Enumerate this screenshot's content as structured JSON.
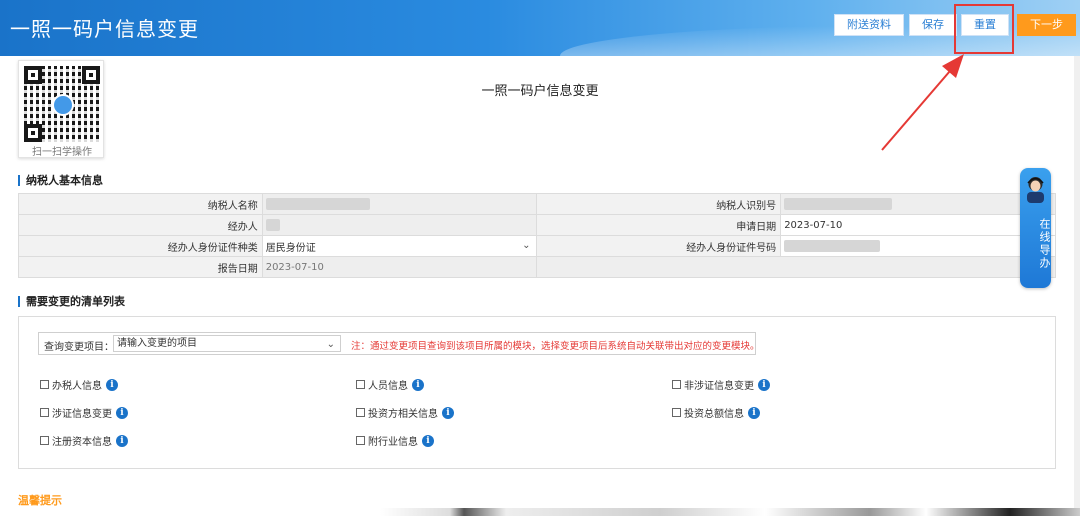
{
  "header": {
    "title": "一照一码户信息变更",
    "buttons": {
      "attach": "附送资料",
      "save": "保存",
      "reset": "重置",
      "next": "下一步"
    }
  },
  "qr": {
    "caption": "扫一扫学操作"
  },
  "page_title": "一照一码户信息变更",
  "basic_info": {
    "section_title": "纳税人基本信息",
    "fields": {
      "taxpayer_name_label": "纳税人名称",
      "taxpayer_id_label": "纳税人识别号",
      "agent_label": "经办人",
      "apply_date_label": "申请日期",
      "apply_date_value": "2023-07-10",
      "agent_id_type_label": "经办人身份证件种类",
      "agent_id_type_value": "居民身份证",
      "agent_id_no_label": "经办人身份证件号码",
      "report_date_label": "报告日期",
      "report_date_value": "2023-07-10"
    }
  },
  "change_list": {
    "section_title": "需要变更的清单列表",
    "query_label": "查询变更项目：",
    "query_placeholder": "请输入变更的项目",
    "note": "注：通过变更项目查询到该项目所属的模块，选择变更项目后系统自动关联带出对应的变更模块。",
    "items": [
      "办税人信息",
      "人员信息",
      "非涉证信息变更",
      "涉证信息变更",
      "投资方相关信息",
      "投资总额信息",
      "注册资本信息",
      "附行业信息"
    ]
  },
  "tips_title": "温馨提示",
  "online_guide": {
    "label": "在线导办"
  },
  "icons": {
    "checkbox": "checkbox-icon",
    "info": "info-icon",
    "chevron": "chevron-down-icon",
    "arrow": "red-arrow-icon"
  },
  "colors": {
    "header_blue": "#1a73c9",
    "next_orange": "#ff9a1c",
    "note_red": "#e53935"
  }
}
